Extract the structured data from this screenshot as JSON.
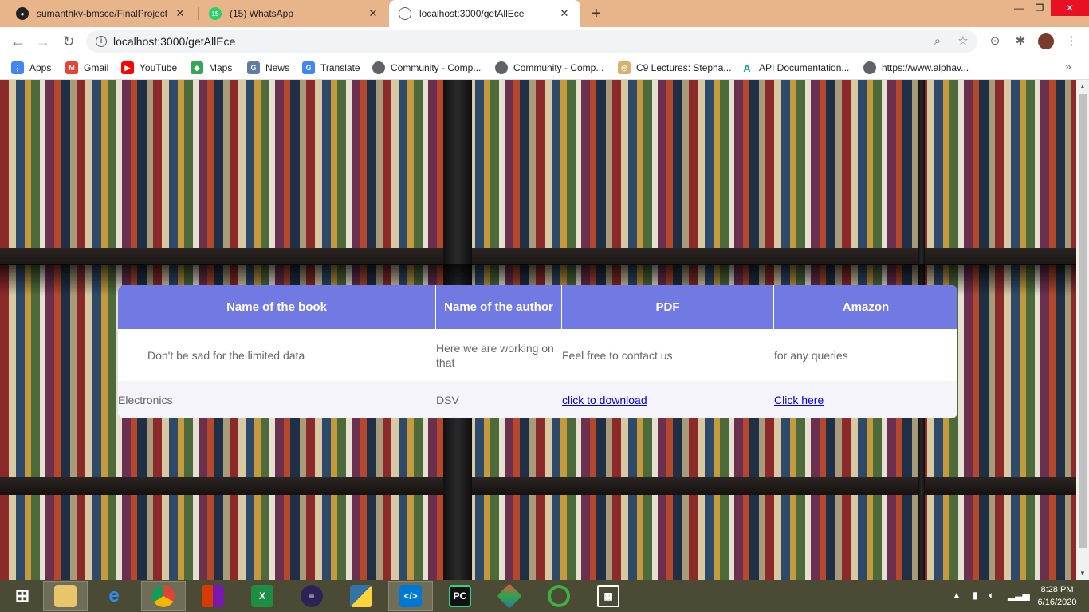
{
  "tabs": [
    {
      "title": "sumanthkv-bmsce/FinalProject",
      "icon": "github-icon"
    },
    {
      "title": "(15) WhatsApp",
      "icon": "whatsapp-icon",
      "badge": "15"
    },
    {
      "title": "localhost:3000/getAllEce",
      "icon": "globe-icon"
    }
  ],
  "toolbar": {
    "url": "localhost:3000/getAllEce"
  },
  "bookmarks": [
    {
      "label": "Apps",
      "icon": "apps-grid-icon"
    },
    {
      "label": "Gmail",
      "icon": "gmail-icon"
    },
    {
      "label": "YouTube",
      "icon": "youtube-icon"
    },
    {
      "label": "Maps",
      "icon": "maps-icon"
    },
    {
      "label": "News",
      "icon": "news-icon"
    },
    {
      "label": "Translate",
      "icon": "translate-icon"
    },
    {
      "label": "Community - Comp...",
      "icon": "globe-icon"
    },
    {
      "label": "Community - Comp...",
      "icon": "globe-icon"
    },
    {
      "label": "C9 Lectures: Stepha...",
      "icon": "c9-icon"
    },
    {
      "label": "API Documentation...",
      "icon": "api-icon"
    },
    {
      "label": "https://www.alphav...",
      "icon": "globe-icon"
    }
  ],
  "table": {
    "headers": [
      "Name of the book",
      "Name of the author",
      "PDF",
      "Amazon"
    ],
    "notice_row": [
      "Don't be sad for the limited data",
      "Here we are working on that",
      "Feel free to contact us",
      "for any queries"
    ],
    "rows": [
      {
        "book": "Electronics",
        "author": "DSV",
        "pdf_link": "click to download",
        "amazon_link": "Click here"
      }
    ]
  },
  "taskbar": {
    "apps": [
      "start-icon",
      "file-explorer-icon",
      "internet-explorer-icon",
      "chrome-icon",
      "office-icon",
      "excel-icon",
      "eclipse-icon",
      "python-icon",
      "vscode-icon",
      "pycharm-icon",
      "git-icon",
      "cycle-icon",
      "calculator-icon"
    ],
    "time": "8:28 PM",
    "date": "6/16/2020"
  },
  "colors": {
    "tab_strip": "#e8b48a",
    "table_header": "#7179e2",
    "link": "#0000ee",
    "taskbar": "#4b4b35"
  }
}
